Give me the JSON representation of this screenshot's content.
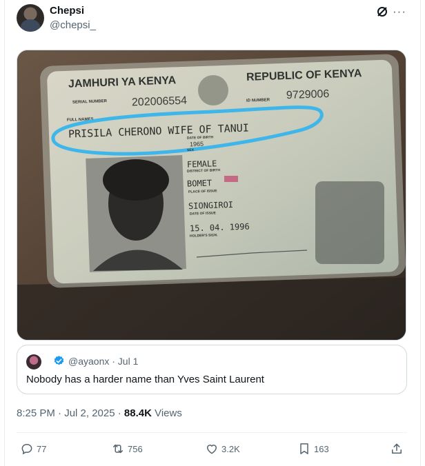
{
  "author": {
    "display_name": "Chepsi",
    "handle": "@chepsi_"
  },
  "header_icons": [
    "grok-icon",
    "more-icon"
  ],
  "more_glyph": "···",
  "media": {
    "id_card": {
      "heading_left": "JAMHURI YA KENYA",
      "heading_right": "REPUBLIC OF KENYA",
      "serial_label": "SERIAL NUMBER",
      "serial_number": "202006554",
      "id_label": "ID NUMBER",
      "id_number": "9729006",
      "full_names_label": "FULL NAMES",
      "full_names": "PRISILA CHERONO WIFE OF TANUI",
      "dob_label": "DATE OF BIRTH",
      "dob_value": "1965",
      "sex_label": "SEX",
      "sex": "FEMALE",
      "district_label": "DISTRICT OF BIRTH",
      "district": "BOMET",
      "place_label": "PLACE OF ISSUE",
      "place": "SIONGIROI",
      "issue_label": "DATE OF ISSUE",
      "issue_date": "15. 04. 1996",
      "sign_label": "HOLDER'S SIGN."
    },
    "highlight_color": "#3fb6ea"
  },
  "quote": {
    "handle_time": "@ayaonx · Jul 1",
    "text": "Nobody has a harder name than Yves Saint Laurent",
    "verified_color": "#1d9bf0"
  },
  "meta": {
    "timestamp": "8:25 PM · Jul 2, 2025 · ",
    "views_count": "88.4K",
    "views_label": " Views"
  },
  "actions": {
    "reply": "77",
    "repost": "756",
    "like": "3.2K",
    "bookmark": "163"
  }
}
